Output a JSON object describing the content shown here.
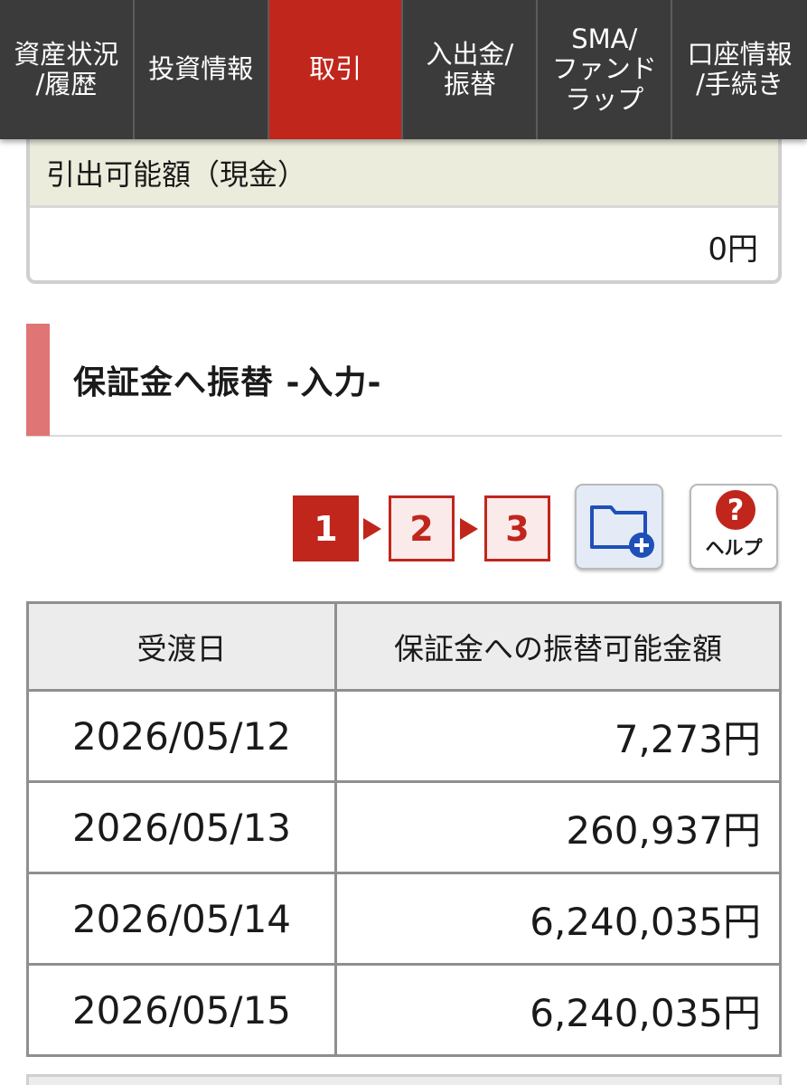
{
  "nav": {
    "tabs": [
      {
        "label": "資産状況\n/履歴",
        "active": false
      },
      {
        "label": "投資情報",
        "active": false
      },
      {
        "label": "取引",
        "active": true
      },
      {
        "label": "入出金/\n振替",
        "active": false
      },
      {
        "label": "SMA/\nファンド\nラップ",
        "active": false
      },
      {
        "label": "口座情報\n/手続き",
        "active": false
      }
    ]
  },
  "cash": {
    "label": "引出可能額（現金）",
    "value": "0円"
  },
  "section": {
    "title": "保証金へ振替 -入力-"
  },
  "steps": [
    "1",
    "2",
    "3"
  ],
  "icons": {
    "folder_icon": "folder-plus-icon",
    "help_icon": "question-circle-icon"
  },
  "help_label": "ヘルプ",
  "table": {
    "headers": [
      "受渡日",
      "保証金への振替可能金額"
    ],
    "rows": [
      {
        "date": "2026/05/12",
        "amount": "7,273円"
      },
      {
        "date": "2026/05/13",
        "amount": "260,937円"
      },
      {
        "date": "2026/05/14",
        "amount": "6,240,035円"
      },
      {
        "date": "2026/05/15",
        "amount": "6,240,035円"
      }
    ]
  },
  "colors": {
    "accent_red": "#c0261c",
    "nav_bg": "#3b3b3b",
    "heading_bar": "#e07575",
    "folder_blue": "#1f4fb8"
  }
}
